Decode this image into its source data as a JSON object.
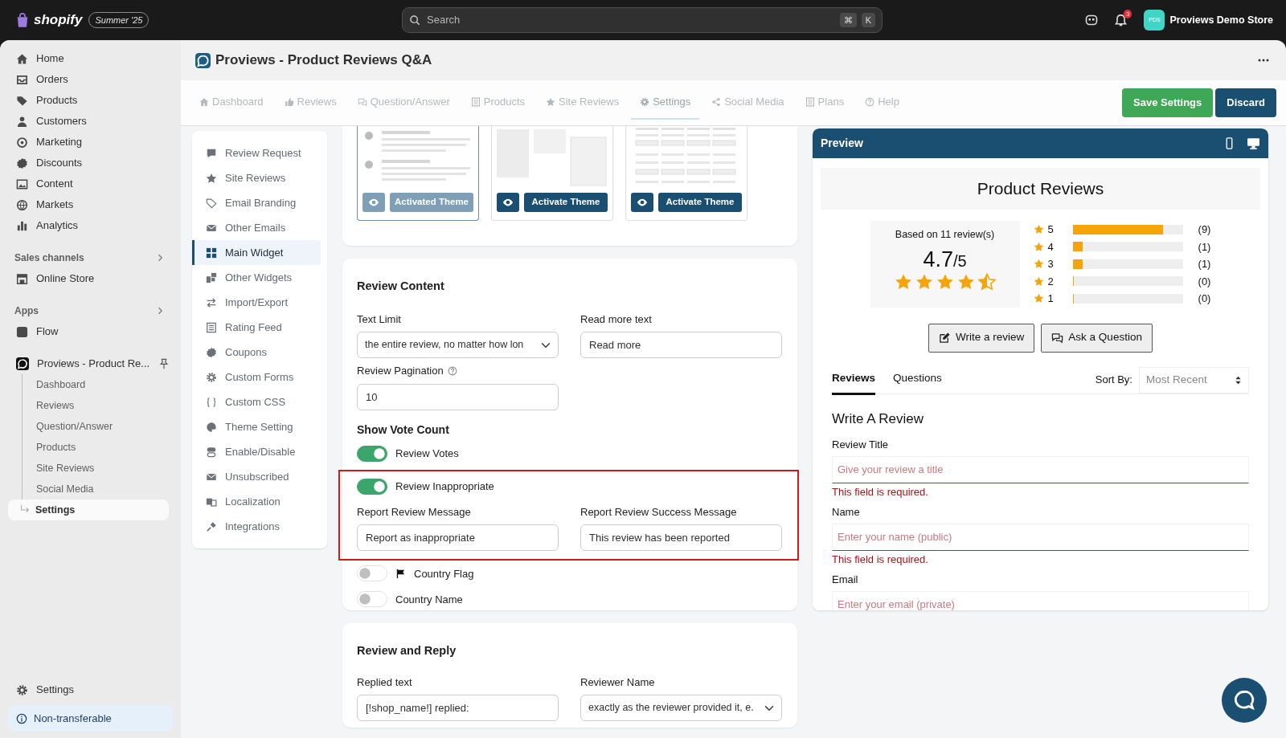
{
  "topbar": {
    "brand": "shopify",
    "edition": "Summer '25",
    "search": {
      "placeholder": "Search",
      "shortcut_keys": [
        "⌘",
        "K"
      ]
    },
    "notification_count": "3",
    "store": {
      "initials": "PDS",
      "name": "Proviews Demo Store"
    }
  },
  "sidebar": {
    "items": [
      {
        "label": "Home"
      },
      {
        "label": "Orders"
      },
      {
        "label": "Products"
      },
      {
        "label": "Customers"
      },
      {
        "label": "Marketing"
      },
      {
        "label": "Discounts"
      },
      {
        "label": "Content"
      },
      {
        "label": "Markets"
      },
      {
        "label": "Analytics"
      }
    ],
    "sections": [
      {
        "title": "Sales channels",
        "items": [
          {
            "label": "Online Store"
          }
        ]
      },
      {
        "title": "Apps",
        "items": [
          {
            "label": "Flow"
          }
        ]
      }
    ],
    "app": {
      "label": "Proviews - Product Re...",
      "children": [
        {
          "label": "Dashboard",
          "selected": false
        },
        {
          "label": "Reviews",
          "selected": false
        },
        {
          "label": "Question/Answer",
          "selected": false
        },
        {
          "label": "Products",
          "selected": false
        },
        {
          "label": "Site Reviews",
          "selected": false
        },
        {
          "label": "Social Media",
          "selected": false
        },
        {
          "label": "Settings",
          "selected": true
        }
      ]
    },
    "footer_item": "Settings",
    "notice": "Non-transferable"
  },
  "page": {
    "title": "Proviews - Product Reviews Q&A"
  },
  "app_tabs": [
    {
      "label": "Dashboard",
      "selected": false
    },
    {
      "label": "Reviews",
      "selected": false
    },
    {
      "label": "Question/Answer",
      "selected": false
    },
    {
      "label": "Products",
      "selected": false
    },
    {
      "label": "Site Reviews",
      "selected": false
    },
    {
      "label": "Settings",
      "selected": true
    },
    {
      "label": "Social Media",
      "selected": false
    },
    {
      "label": "Plans",
      "selected": false
    },
    {
      "label": "Help",
      "selected": false
    }
  ],
  "actions": [
    {
      "label": "Save Settings",
      "kind": "primary"
    },
    {
      "label": "Discard",
      "kind": "secondary"
    }
  ],
  "settings_menu": [
    {
      "label": "Review Request",
      "selected": false
    },
    {
      "label": "Site Reviews",
      "selected": false
    },
    {
      "label": "Email Branding",
      "selected": false
    },
    {
      "label": "Other Emails",
      "selected": false
    },
    {
      "label": "Main Widget",
      "selected": true
    },
    {
      "label": "Other Widgets",
      "selected": false
    },
    {
      "label": "Import/Export",
      "selected": false
    },
    {
      "label": "Rating Feed",
      "selected": false
    },
    {
      "label": "Coupons",
      "selected": false
    },
    {
      "label": "Custom Forms",
      "selected": false
    },
    {
      "label": "Custom CSS",
      "selected": false
    },
    {
      "label": "Theme Setting",
      "selected": false
    },
    {
      "label": "Enable/Disable",
      "selected": false
    },
    {
      "label": "Unsubscribed",
      "selected": false
    },
    {
      "label": "Localization",
      "selected": false
    },
    {
      "label": "Integrations",
      "selected": false
    }
  ],
  "themes": [
    {
      "button": "Activated Theme",
      "activated": true
    },
    {
      "button": "Activate Theme",
      "activated": false
    },
    {
      "button": "Activate Theme",
      "activated": false
    }
  ],
  "review_content": {
    "title": "Review Content",
    "fields": [
      {
        "label": "Text Limit",
        "value": "the entire review, no matter how lon",
        "kind": "select"
      },
      {
        "label": "Read more text",
        "value": "Read more",
        "kind": "input"
      }
    ],
    "pagination": {
      "label": "Review Pagination",
      "value": "10"
    },
    "vote_heading": "Show Vote Count",
    "toggles_top": [
      {
        "label": "Review Votes",
        "on": true
      }
    ],
    "highlight": {
      "toggle": {
        "label": "Review Inappropriate",
        "on": true
      },
      "fields": [
        {
          "label": "Report Review Message",
          "value": "Report as inappropriate",
          "kind": "input"
        },
        {
          "label": "Report Review Success Message",
          "value": "This review has been reported",
          "kind": "input"
        }
      ]
    },
    "toggles_bottom": [
      {
        "label": "Country Flag",
        "on": false,
        "kind": "with-icon"
      },
      {
        "label": "Country Name",
        "on": false,
        "kind": "plain"
      }
    ]
  },
  "review_reply": {
    "title": "Review and Reply",
    "fields": [
      {
        "label": "Replied text",
        "value": "[!shop_name!] replied:",
        "kind": "input"
      },
      {
        "label": "Reviewer Name",
        "value": "exactly as the reviewer provided it, e.",
        "kind": "select"
      }
    ]
  },
  "preview": {
    "title": "Preview",
    "heading": "Product Reviews",
    "summary": {
      "based_on": "Based on 11 review(s)",
      "score": "4.7",
      "out_of": "/5",
      "stars": 4.5
    },
    "distribution": [
      {
        "label": "5",
        "count": "(9)",
        "level": 0.82
      },
      {
        "label": "4",
        "count": "(1)",
        "level": 0.09
      },
      {
        "label": "3",
        "count": "(1)",
        "level": 0.09
      },
      {
        "label": "2",
        "count": "(0)",
        "level": 0
      },
      {
        "label": "1",
        "count": "(0)",
        "level": 0
      }
    ],
    "buttons": [
      {
        "label": "Write a review"
      },
      {
        "label": "Ask a Question"
      }
    ],
    "tabs": [
      {
        "label": "Reviews",
        "selected": true
      },
      {
        "label": "Questions",
        "selected": false
      }
    ],
    "sort": {
      "label": "Sort By:",
      "value": "Most Recent"
    },
    "form": {
      "title": "Write A Review",
      "fields": [
        {
          "label": "Review Title",
          "placeholder": "Give your review a title",
          "error": "This field is required."
        },
        {
          "label": "Name",
          "placeholder": "Enter your name (public)",
          "error": "This field is required."
        },
        {
          "label": "Email",
          "placeholder": "Enter your email (private)"
        }
      ]
    }
  }
}
